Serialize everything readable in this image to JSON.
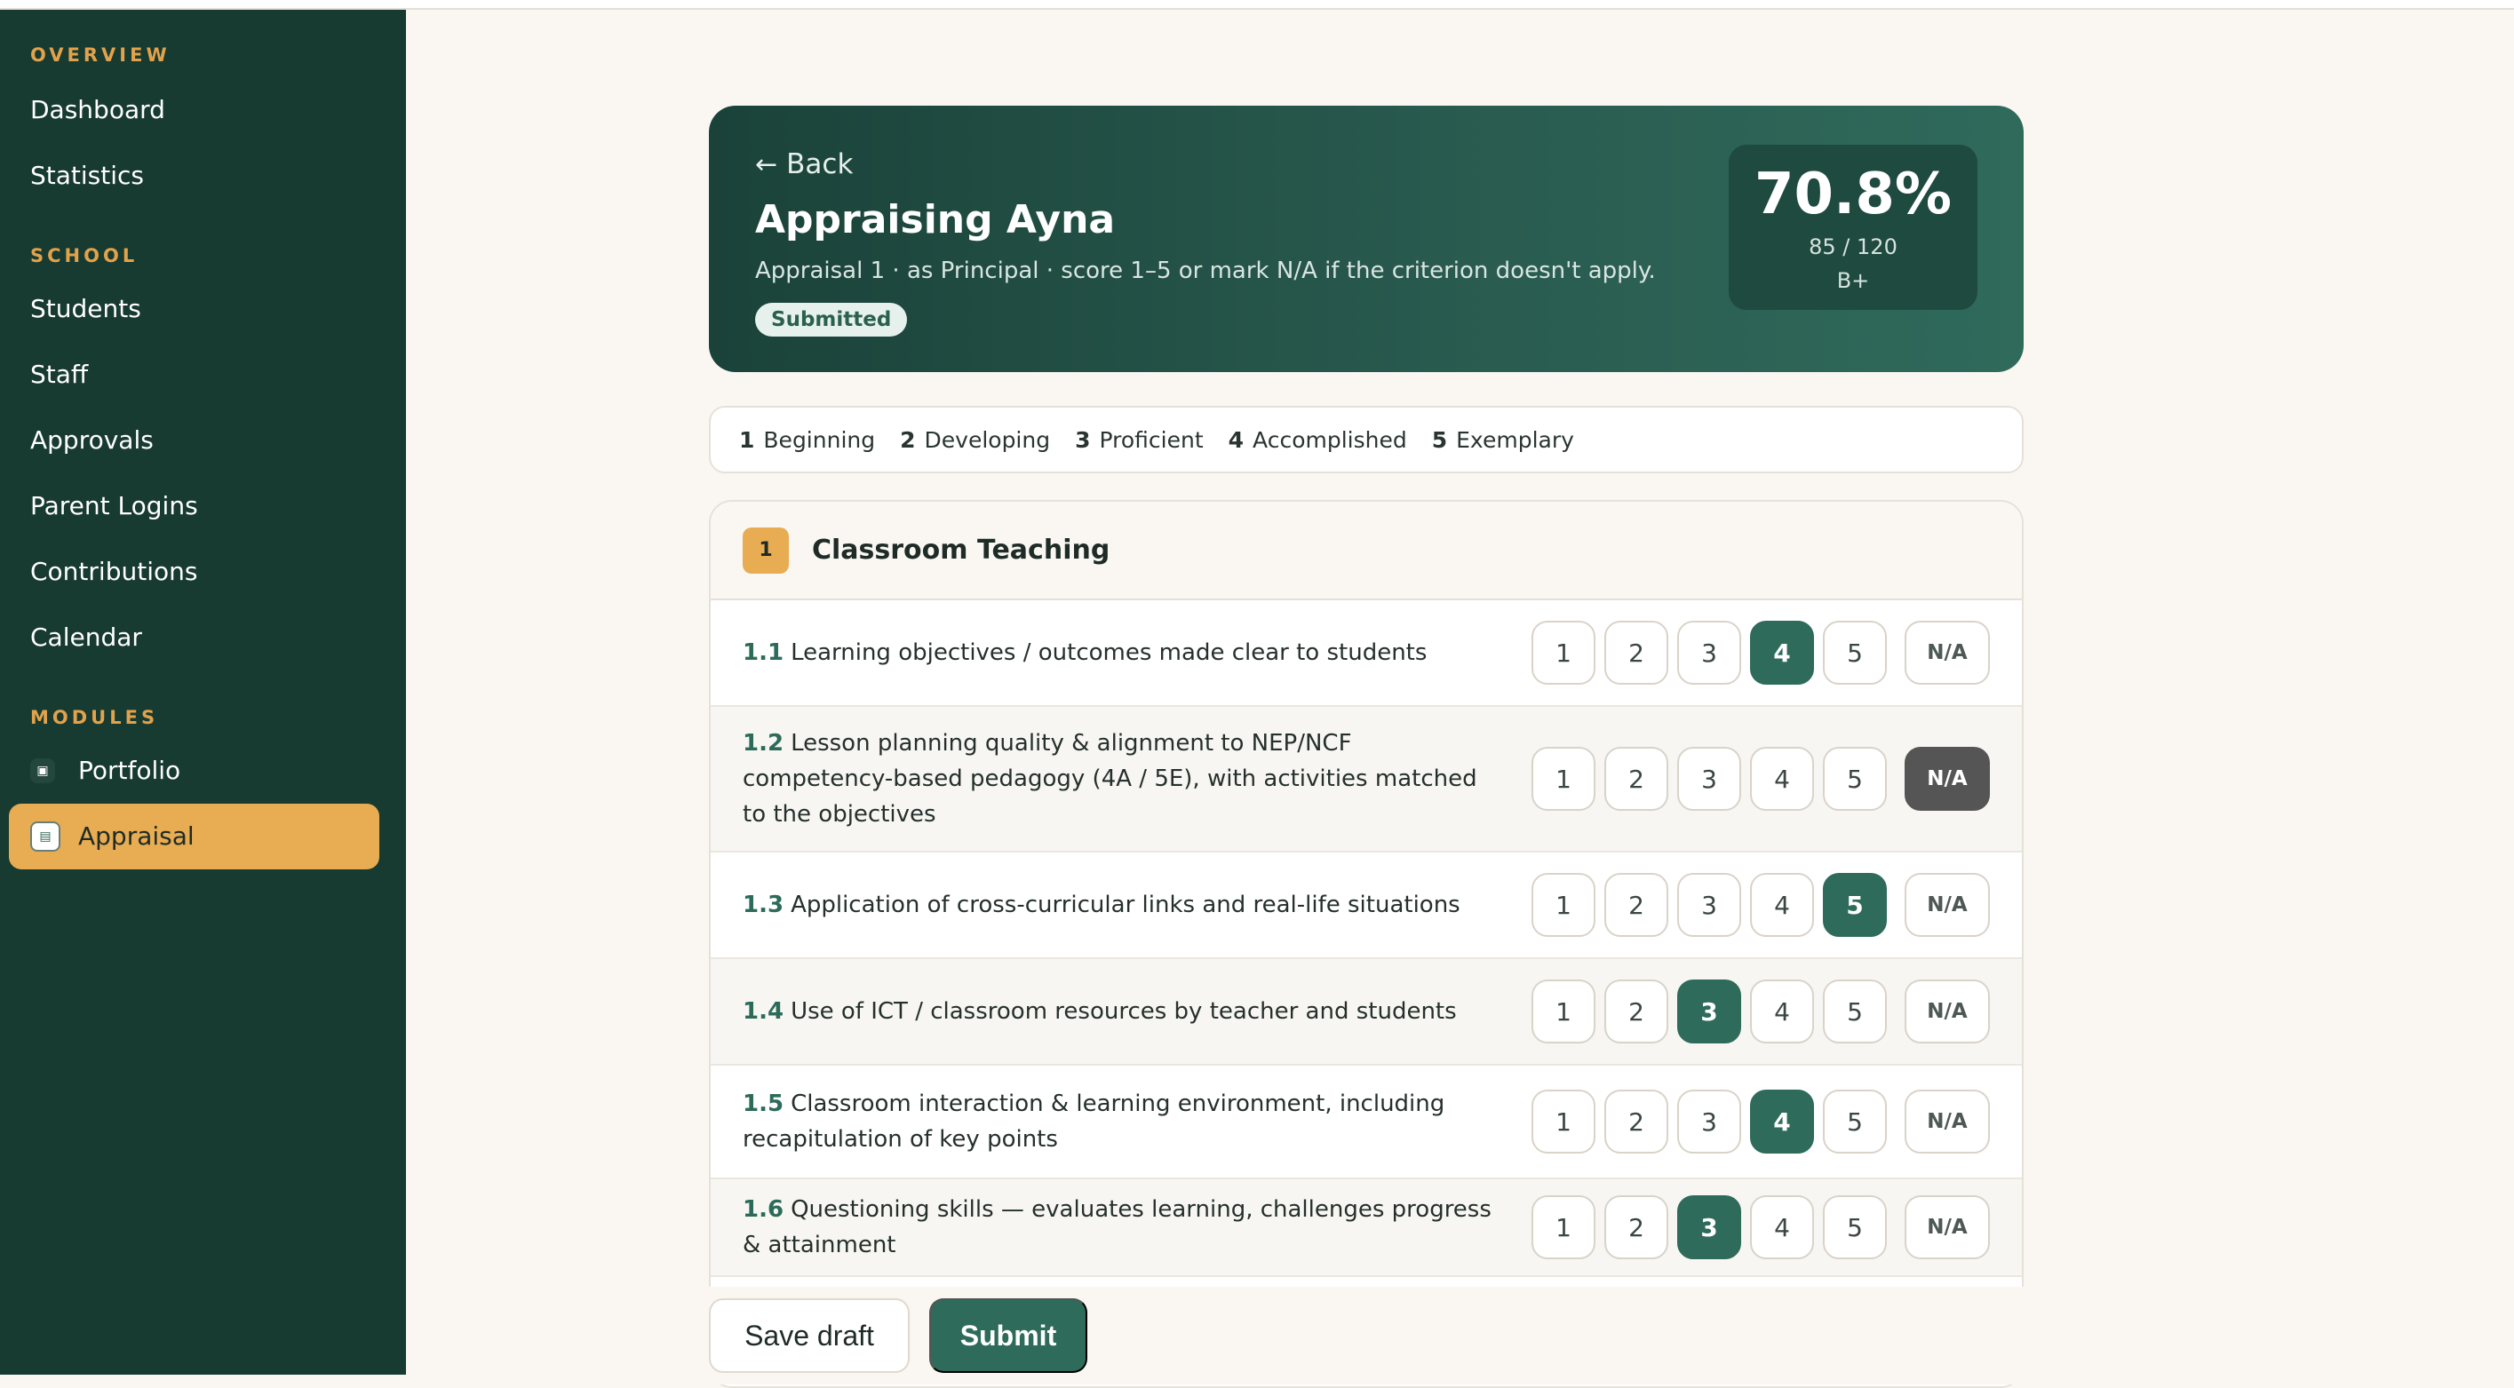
{
  "sidebar": {
    "sections": [
      {
        "title": "OVERVIEW",
        "items": [
          "Dashboard",
          "Statistics"
        ]
      },
      {
        "title": "SCHOOL",
        "items": [
          "Students",
          "Staff",
          "Approvals",
          "Parent Logins",
          "Contributions",
          "Calendar"
        ]
      },
      {
        "title": "MODULES",
        "items": [
          "Portfolio",
          "Appraisal"
        ]
      }
    ],
    "active": "Appraisal"
  },
  "header": {
    "back_label": "Back",
    "title": "Appraising Ayna",
    "subtitle": "Appraisal 1 · as Principal · score 1–5 or mark N/A if the criterion doesn't apply.",
    "status": "Submitted",
    "score_percent": "70.8%",
    "score_points": "85 / 120",
    "grade": "B+"
  },
  "legend": [
    {
      "num": "1",
      "label": "Beginning"
    },
    {
      "num": "2",
      "label": "Developing"
    },
    {
      "num": "3",
      "label": "Proficient"
    },
    {
      "num": "4",
      "label": "Accomplished"
    },
    {
      "num": "5",
      "label": "Exemplary"
    }
  ],
  "section": {
    "number": "1",
    "title": "Classroom Teaching",
    "criteria": [
      {
        "num": "1.1",
        "text": "Learning objectives / outcomes made clear to students",
        "selected": "4"
      },
      {
        "num": "1.2",
        "text": "Lesson planning quality & alignment to NEP/NCF competency-based pedagogy (4A / 5E), with activities matched to the objectives",
        "selected": "N/A"
      },
      {
        "num": "1.3",
        "text": "Application of cross-curricular links and real-life situations",
        "selected": "5"
      },
      {
        "num": "1.4",
        "text": "Use of ICT / classroom resources by teacher and students",
        "selected": "3"
      },
      {
        "num": "1.5",
        "text": "Classroom interaction & learning environment, including recapitulation of key points",
        "selected": "4"
      },
      {
        "num": "1.6",
        "text": "Questioning skills — evaluates learning, challenges progress & attainment",
        "selected": "3"
      }
    ],
    "options": [
      "1",
      "2",
      "3",
      "4",
      "5",
      "N/A"
    ]
  },
  "actions": {
    "save_label": "Save draft",
    "submit_label": "Submit"
  }
}
